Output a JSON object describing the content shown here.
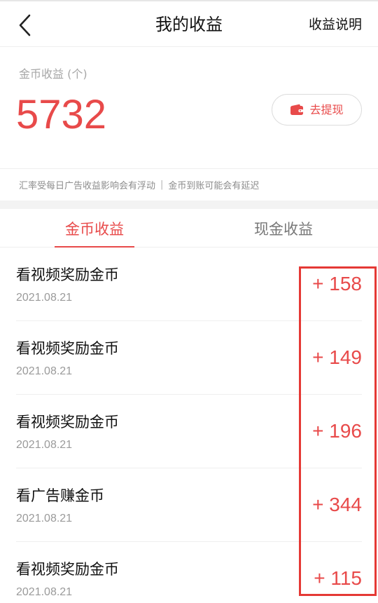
{
  "header": {
    "title": "我的收益",
    "help_label": "收益说明"
  },
  "balance": {
    "label": "金币收益 (个)",
    "value": "5732",
    "withdraw_label": "去提现"
  },
  "notice": {
    "left": "汇率受每日广告收益影响会有浮动",
    "separator": "|",
    "right": "金币到账可能会有延迟"
  },
  "tabs": [
    {
      "label": "金币收益",
      "active": true
    },
    {
      "label": "现金收益",
      "active": false
    }
  ],
  "records": [
    {
      "title": "看视频奖励金币",
      "date": "2021.08.21",
      "amount": "+ 158"
    },
    {
      "title": "看视频奖励金币",
      "date": "2021.08.21",
      "amount": "+ 149"
    },
    {
      "title": "看视频奖励金币",
      "date": "2021.08.21",
      "amount": "+ 196"
    },
    {
      "title": "看广告赚金币",
      "date": "2021.08.21",
      "amount": "+ 344"
    },
    {
      "title": "看视频奖励金币",
      "date": "2021.08.21",
      "amount": "+ 115"
    }
  ],
  "colors": {
    "accent": "#e84a4a",
    "highlight": "#e53935"
  }
}
